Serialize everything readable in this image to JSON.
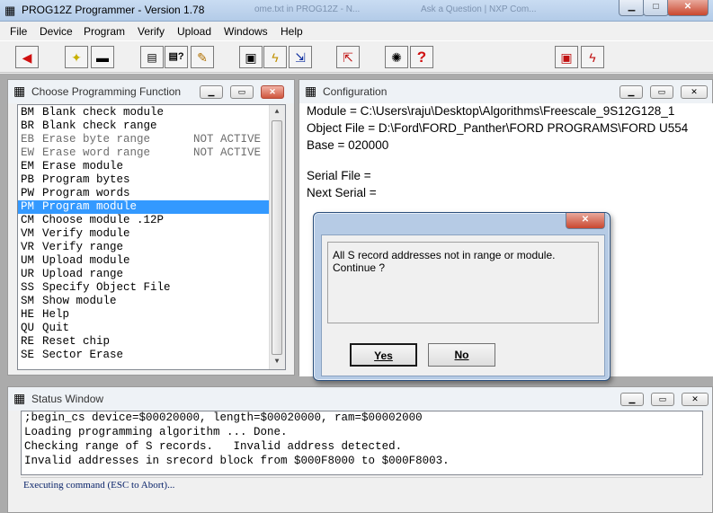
{
  "window": {
    "title": "PROG12Z Programmer - Version 1.78"
  },
  "background_tabs": [
    "ome.txt in PROG12Z - N...",
    "Ask a Question | NXP Com..."
  ],
  "menu": [
    "File",
    "Device",
    "Program",
    "Verify",
    "Upload",
    "Windows",
    "Help"
  ],
  "toolbar_icons": [
    "back-arrow-icon",
    "bulb-icon",
    "chip-icon",
    "list-icon",
    "query-list-icon",
    "pencil-icon",
    "save-icon",
    "lightning-icon",
    "download-icon",
    "upload-icon",
    "settings-icon",
    "help-icon",
    "save-red-icon",
    "program-red-icon"
  ],
  "choose": {
    "title": "Choose Programming Function",
    "items": [
      {
        "code": "BM",
        "label": "Blank check module",
        "status": ""
      },
      {
        "code": "BR",
        "label": "Blank check range",
        "status": ""
      },
      {
        "code": "EB",
        "label": "Erase byte range",
        "status": "NOT ACTIVE"
      },
      {
        "code": "EW",
        "label": "Erase word range",
        "status": "NOT ACTIVE"
      },
      {
        "code": "EM",
        "label": "Erase module",
        "status": ""
      },
      {
        "code": "PB",
        "label": "Program bytes",
        "status": ""
      },
      {
        "code": "PW",
        "label": "Program words",
        "status": ""
      },
      {
        "code": "PM",
        "label": "Program module",
        "status": ""
      },
      {
        "code": "CM",
        "label": "Choose module .12P",
        "status": ""
      },
      {
        "code": "VM",
        "label": "Verify module",
        "status": ""
      },
      {
        "code": "VR",
        "label": "Verify range",
        "status": ""
      },
      {
        "code": "UM",
        "label": "Upload module",
        "status": ""
      },
      {
        "code": "UR",
        "label": "Upload range",
        "status": ""
      },
      {
        "code": "SS",
        "label": "Specify Object File",
        "status": ""
      },
      {
        "code": "SM",
        "label": "Show module",
        "status": ""
      },
      {
        "code": "HE",
        "label": "Help",
        "status": ""
      },
      {
        "code": "QU",
        "label": "Quit",
        "status": ""
      },
      {
        "code": "RE",
        "label": "Reset chip",
        "status": ""
      },
      {
        "code": "SE",
        "label": "Sector Erase",
        "status": ""
      }
    ],
    "selected_index": 7
  },
  "config": {
    "title": "Configuration",
    "module": "Module = C:\\Users\\raju\\Desktop\\Algorithms\\Freescale_9S12G128_1",
    "object_file": "Object File = D:\\Ford\\FORD_Panther\\FORD PROGRAMS\\FORD U554",
    "base": "Base = 020000",
    "serial_file": "Serial File =",
    "next_serial": "Next Serial ="
  },
  "dialog": {
    "message_line1": "All S record addresses not in range or module.",
    "message_line2": "Continue ?",
    "yes": "Yes",
    "no": "No"
  },
  "status": {
    "title": "Status Window",
    "lines": [
      ";begin_cs device=$00020000, length=$00020000, ram=$00002000",
      "Loading programming algorithm ... Done.",
      "Checking range of S records.   Invalid address detected.",
      "Invalid addresses in srecord block from $000F8000 to $000F8003."
    ],
    "footer": "Executing command (ESC to Abort)..."
  }
}
